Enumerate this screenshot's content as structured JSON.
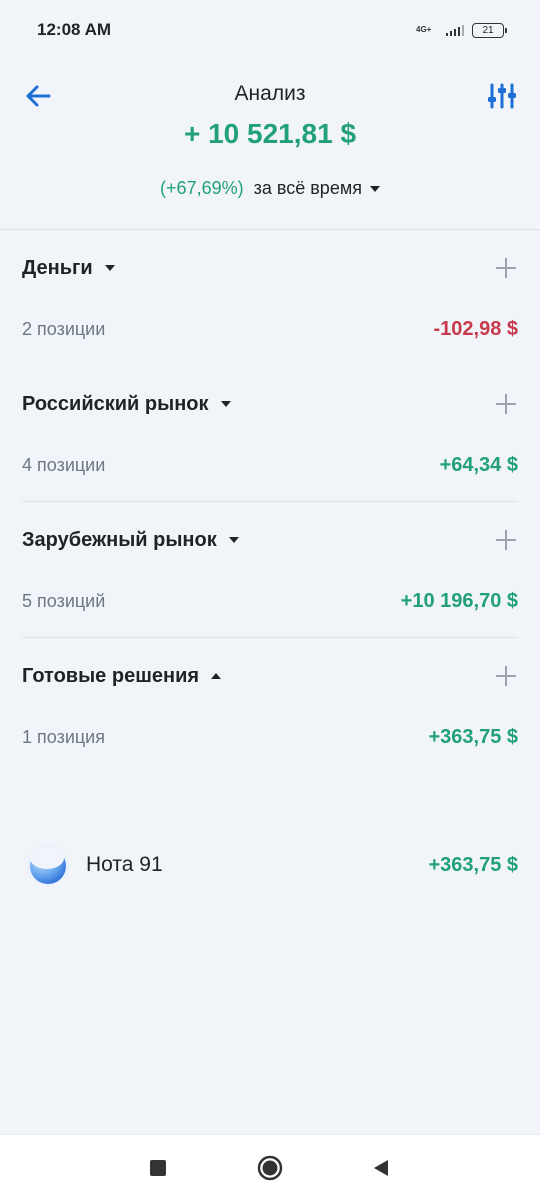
{
  "status": {
    "time": "12:08 AM",
    "network": "4G+",
    "battery": "21"
  },
  "header": {
    "title": "Анализ",
    "total": "+ 10 521,81 $",
    "percent": "(+67,69%)",
    "period": "за всё время"
  },
  "groups": [
    {
      "title": "Деньги",
      "count": "2 позиции",
      "value": "-102,98 $",
      "sign": "negative",
      "expanded": false
    },
    {
      "title": "Российский рынок",
      "count": "4 позиции",
      "value": "+64,34 $",
      "sign": "positive",
      "expanded": false
    },
    {
      "title": "Зарубежный рынок",
      "count": "5 позиций",
      "value": "+10 196,70 $",
      "sign": "positive",
      "expanded": false
    },
    {
      "title": "Готовые решения",
      "count": "1 позиция",
      "value": "+363,75 $",
      "sign": "positive",
      "expanded": true
    }
  ],
  "position": {
    "name": "Нота 91",
    "value": "+363,75 $",
    "icon": "moon-sphere-icon"
  },
  "colors": {
    "positive": "#21a07b",
    "negative": "#c73a4c",
    "accent": "#1d6fd6",
    "background": "#f1f4f8"
  },
  "nav": {
    "buttons": [
      "recents-square-icon",
      "home-circle-icon",
      "back-triangle-icon"
    ]
  }
}
